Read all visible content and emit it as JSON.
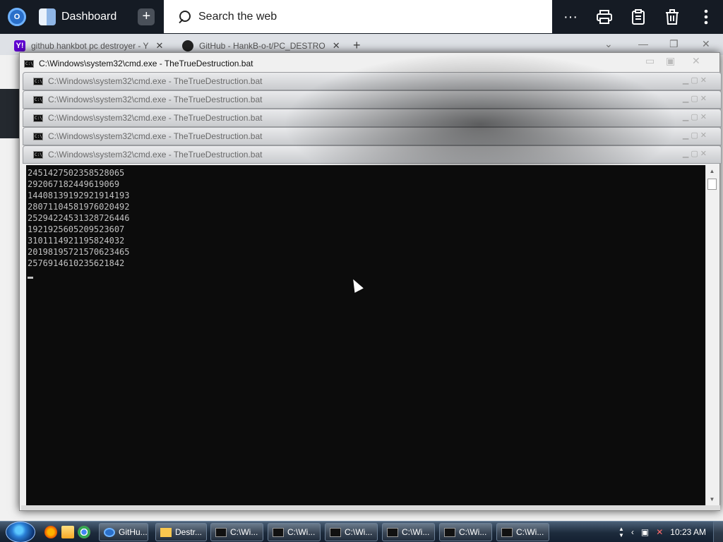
{
  "appbar": {
    "title": "Dashboard",
    "search_placeholder": "Search the web",
    "more_label": "···"
  },
  "tabs": [
    {
      "label": "github hankbot pc destroyer - Y"
    },
    {
      "label": "GitHub - HankB-o-t/PC_DESTRO"
    }
  ],
  "cmd": {
    "main_title": "C:\\Windows\\system32\\cmd.exe - TheTrueDestruction.bat",
    "sub_windows": [
      {
        "title": "C:\\Windows\\system32\\cmd.exe - TheTrueDestruction.bat"
      },
      {
        "title": "C:\\Windows\\system32\\cmd.exe - TheTrueDestruction.bat"
      },
      {
        "title": "C:\\Windows\\system32\\cmd.exe - TheTrueDestruction.bat"
      },
      {
        "title": "C:\\Windows\\system32\\cmd.exe - TheTrueDestruction.bat"
      },
      {
        "title": "C:\\Windows\\system32\\cmd.exe - TheTrueDestruction.bat"
      }
    ],
    "output_lines": [
      "2451427502358528065",
      "292067182449619069",
      "14408139192921914193",
      "28071104581976020492",
      "25294224531328726446",
      "1921925605209523607",
      "3101114921195824032",
      "20198195721570623465",
      "2576914610235621842"
    ]
  },
  "taskbar": {
    "buttons": [
      {
        "label": "GitHu...",
        "icon": "browser-icon"
      },
      {
        "label": "Destr...",
        "icon": "folder-icon"
      },
      {
        "label": "C:\\Wi...",
        "icon": "cmd-icon"
      },
      {
        "label": "C:\\Wi...",
        "icon": "cmd-icon"
      },
      {
        "label": "C:\\Wi...",
        "icon": "cmd-icon"
      },
      {
        "label": "C:\\Wi...",
        "icon": "cmd-icon"
      },
      {
        "label": "C:\\Wi...",
        "icon": "cmd-icon"
      },
      {
        "label": "C:\\Wi...",
        "icon": "cmd-icon"
      }
    ],
    "clock": "10:23 AM"
  }
}
